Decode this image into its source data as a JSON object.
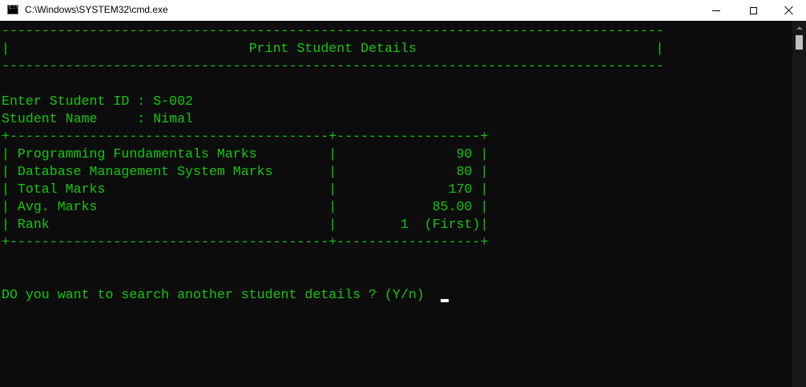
{
  "window": {
    "title": "C:\\Windows\\SYSTEM32\\cmd.exe",
    "icon": "cmd-app-icon",
    "controls": [
      "minimize-icon",
      "maximize-icon",
      "close-icon"
    ]
  },
  "colors": {
    "console_background": "#0c0c0c",
    "console_text": "#16c60c",
    "titlebar_background": "#ffffff"
  },
  "console": {
    "lines": [
      "-----------------------------------------------------------------------------------",
      "|                              Print Student Details                              |",
      "-----------------------------------------------------------------------------------",
      "",
      "Enter Student ID : S-002",
      "Student Name     : Nimal",
      "+----------------------------------------+------------------+",
      "| Programming Fundamentals Marks         |               90 |",
      "| Database Management System Marks       |               80 |",
      "| Total Marks                            |              170 |",
      "| Avg. Marks                             |            85.00 |",
      "| Rank                                   |        1  (First)|",
      "+----------------------------------------+------------------+",
      "",
      "",
      "DO you want to search another student details ? (Y/n)"
    ]
  }
}
